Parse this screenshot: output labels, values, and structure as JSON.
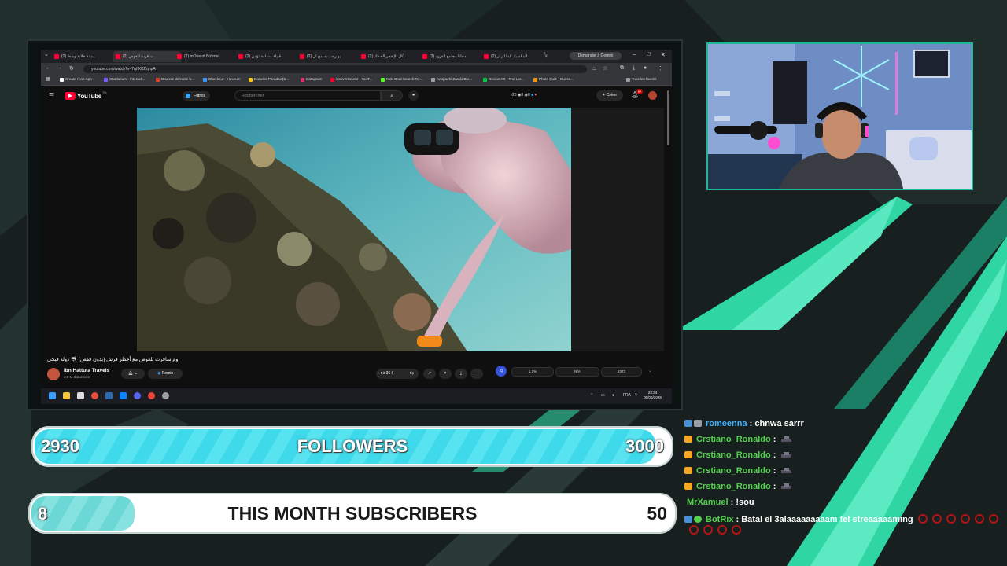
{
  "browser": {
    "tabs": [
      {
        "label": "(2) مدينة خلابة وسط"
      },
      {
        "label": "(2) سافرت للغوص",
        "active": true
      },
      {
        "label": "(2) mOne of Bizerte"
      },
      {
        "label": "(2) قبيلة مسلمة تؤمن"
      },
      {
        "label": "(2) يو رجب يسمح ال"
      },
      {
        "label": "(2) أكل الإنفجر الصعك"
      },
      {
        "label": "(2) دخلنا مجتمع الفرود"
      },
      {
        "label": "(2) المكسيك كما لم تر"
      }
    ],
    "new_tab": "+",
    "gemini_button": "Demander à Gemini",
    "window_controls": [
      "–",
      "□",
      "✕"
    ],
    "url": "youtube.com/watch?v=7qhXK2jqnpA",
    "bookmarks": [
      {
        "label": "Create Next App",
        "color": "#ffffff"
      },
      {
        "label": "Chatlatium - Interact...",
        "color": "#7b5cff"
      },
      {
        "label": "Douleur dernière b...",
        "color": "#e3402b"
      },
      {
        "label": "Checkout - Hexeum",
        "color": "#3a9aff"
      },
      {
        "label": "Darwins Paradox [6...",
        "color": "#f5c518"
      },
      {
        "label": "Instagram",
        "color": "#e1306c"
      },
      {
        "label": "Convertisseur - YouT...",
        "color": "#ff0033"
      },
      {
        "label": "Kick Chat Search Re...",
        "color": "#53fc18"
      },
      {
        "label": "Kenpachi Zaraki Bio...",
        "color": "#9aa0a6"
      },
      {
        "label": "DeviantArt - The Lar...",
        "color": "#05cc47"
      },
      {
        "label": "Photo Quiz - Guess...",
        "color": "#f39c12"
      }
    ],
    "all_bookmarks": "Tous les favoris"
  },
  "youtube": {
    "logo_text": "YouTube",
    "logo_region": "TN",
    "filters_label": "Filtres",
    "search_placeholder": "Rechercher",
    "ext_counts": {
      "a": "25",
      "b": "0",
      "c": "0"
    },
    "create_label": "Créer",
    "notif_count": "9+",
    "video_title": "وم سافرت للغوص مع أخطر قرش (بدون قفص) 🦈 دولة قبجي",
    "channel_name": "Ibn Hattuta Travels",
    "channel_subs": "3,8 M d'abonnés",
    "remix_label": "Remix",
    "likes": "36 k",
    "ext_values": {
      "pct": "1.2%",
      "na": "N/A",
      "num": "2373"
    },
    "ext_badge": "IQ"
  },
  "taskbar": {
    "lang": "FRA",
    "time": "23:34",
    "date": "05/06/2026"
  },
  "overlay": {
    "followers": {
      "current": "2930",
      "label": "FOLLOWERS",
      "goal": "3000",
      "progress": 0.977
    },
    "subscribers": {
      "current": "8",
      "label": "THIS MONTH SUBSCRIBERS",
      "goal": "50",
      "progress": 0.16
    }
  },
  "chat": [
    {
      "user": "romeenna",
      "text": "chnwa sarrr",
      "user_color": "#3fb0ff",
      "badges": [
        "#4a90d9",
        "#9aa0a6"
      ],
      "emote": false
    },
    {
      "user": "Crstiano_Ronaldo",
      "text": "",
      "user_color": "#53d14f",
      "badges": [
        "#f5a623"
      ],
      "emote": true
    },
    {
      "user": "Crstiano_Ronaldo",
      "text": "",
      "user_color": "#53d14f",
      "badges": [
        "#f5a623"
      ],
      "emote": true
    },
    {
      "user": "Crstiano_Ronaldo",
      "text": "",
      "user_color": "#53d14f",
      "badges": [
        "#f5a623"
      ],
      "emote": true
    },
    {
      "user": "Crstiano_Ronaldo",
      "text": "",
      "user_color": "#53d14f",
      "badges": [
        "#f5a623"
      ],
      "emote": true
    },
    {
      "user": "MrXamuel",
      "text": "!sou",
      "user_color": "#53d14f",
      "badges": [],
      "emote": false
    },
    {
      "user": "BotRix",
      "text": "Batal el 3alaaaaaaaaam fel streaaaaaming",
      "user_color": "#53d14f",
      "badges": [
        "#4a90d9",
        "#53d14f"
      ],
      "emote": false
    }
  ]
}
